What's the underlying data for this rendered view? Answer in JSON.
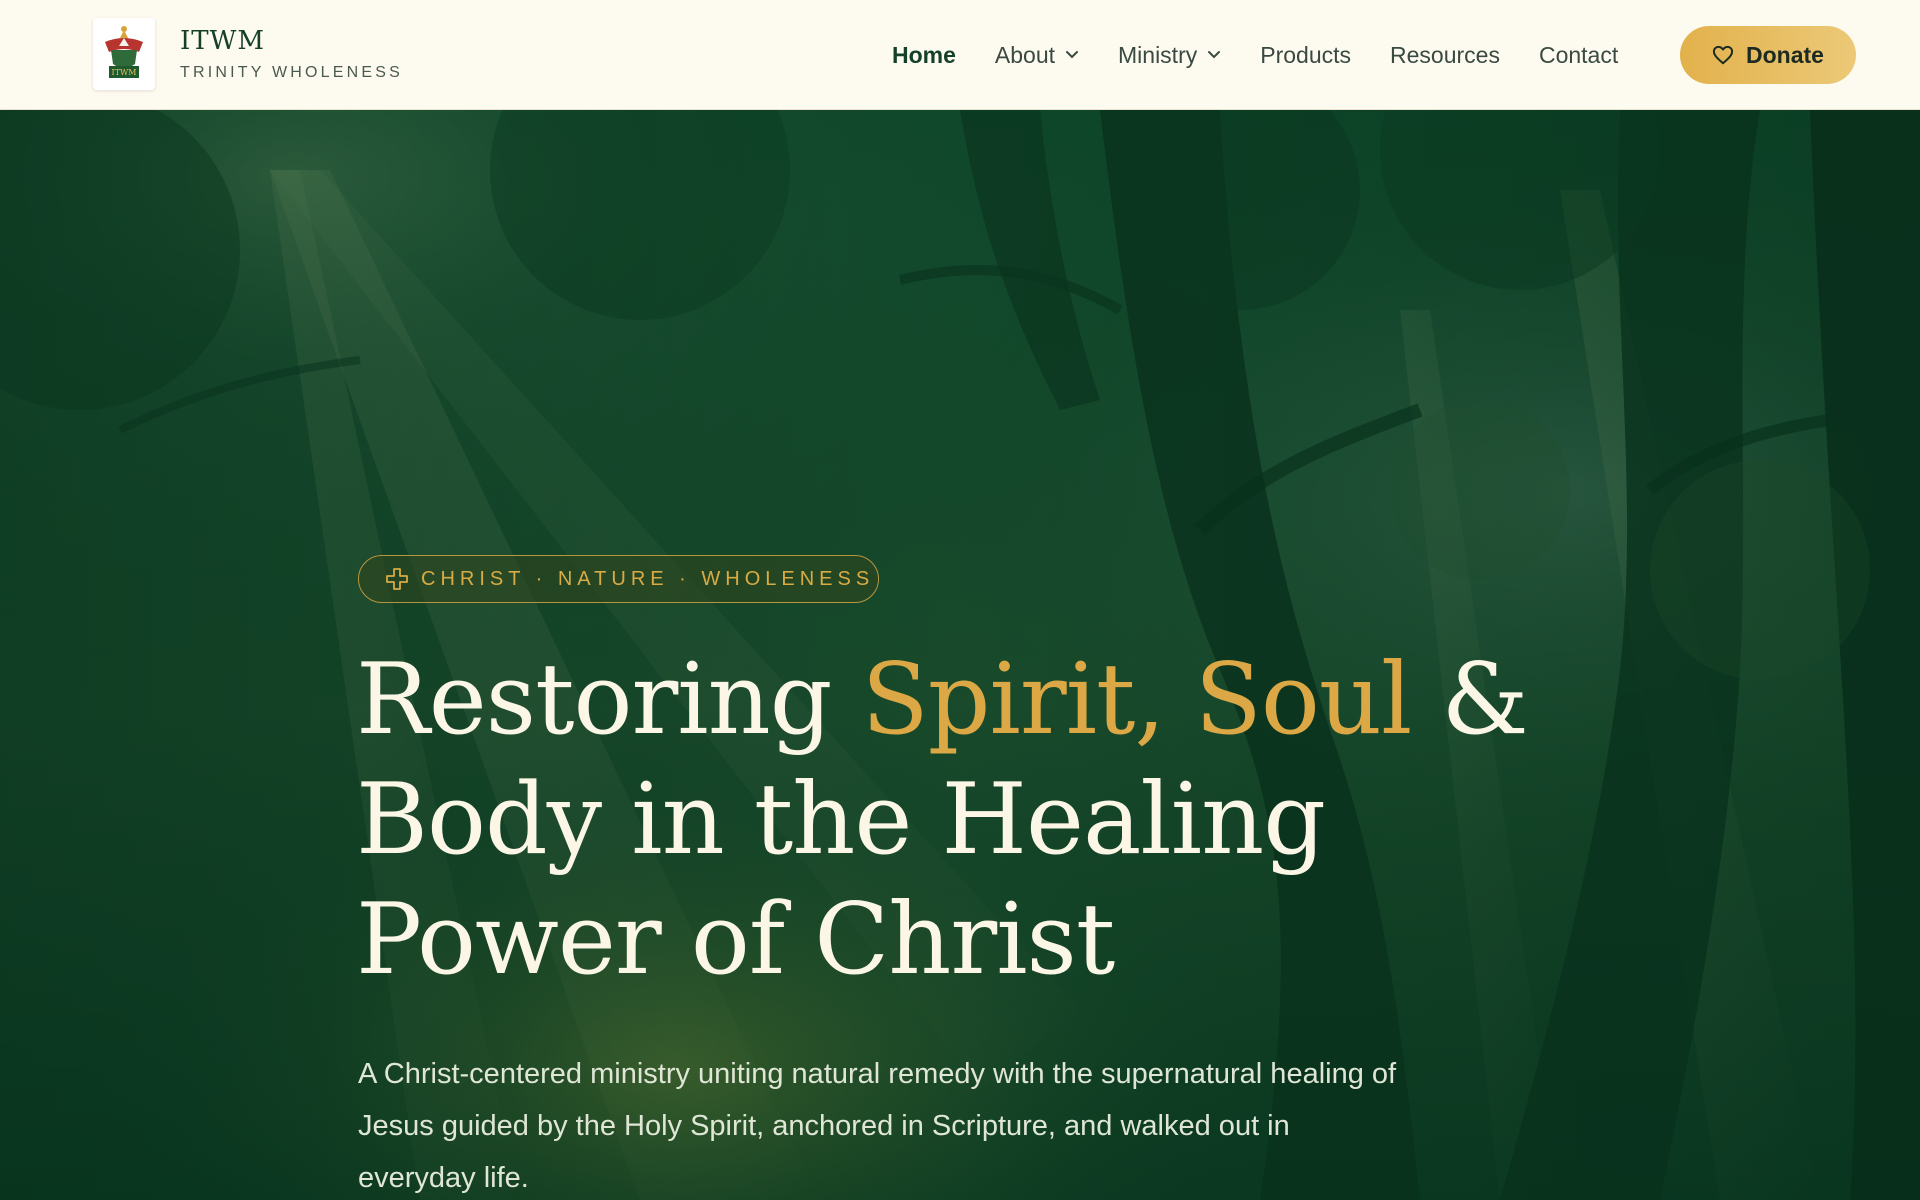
{
  "header": {
    "brand_name": "ITWM",
    "brand_tagline": "TRINITY WHOLENESS",
    "nav": [
      {
        "label": "Home",
        "active": true,
        "dropdown": false
      },
      {
        "label": "About",
        "active": false,
        "dropdown": true
      },
      {
        "label": "Ministry",
        "active": false,
        "dropdown": true
      },
      {
        "label": "Products",
        "active": false,
        "dropdown": false
      },
      {
        "label": "Resources",
        "active": false,
        "dropdown": false
      },
      {
        "label": "Contact",
        "active": false,
        "dropdown": false
      }
    ],
    "donate_label": "Donate",
    "donate_icon": "heart-icon"
  },
  "hero": {
    "badge_icon": "cross-icon",
    "badge_text": "CHRIST · NATURE · WHOLENESS",
    "headline_part1": "Restoring ",
    "headline_highlight": "Spirit, Soul",
    "headline_part2": " & Body in the Healing Power of Christ",
    "subtext": "A Christ-centered ministry uniting natural remedy with the supernatural healing of Jesus guided by the Holy Spirit, anchored in Scripture, and walked out in everyday life."
  },
  "colors": {
    "header_bg": "#fdfaef",
    "brand_green": "#15402a",
    "accent_gold": "#dba845",
    "hero_green": "#0c3a24",
    "headline_text": "#fbf6e6"
  }
}
